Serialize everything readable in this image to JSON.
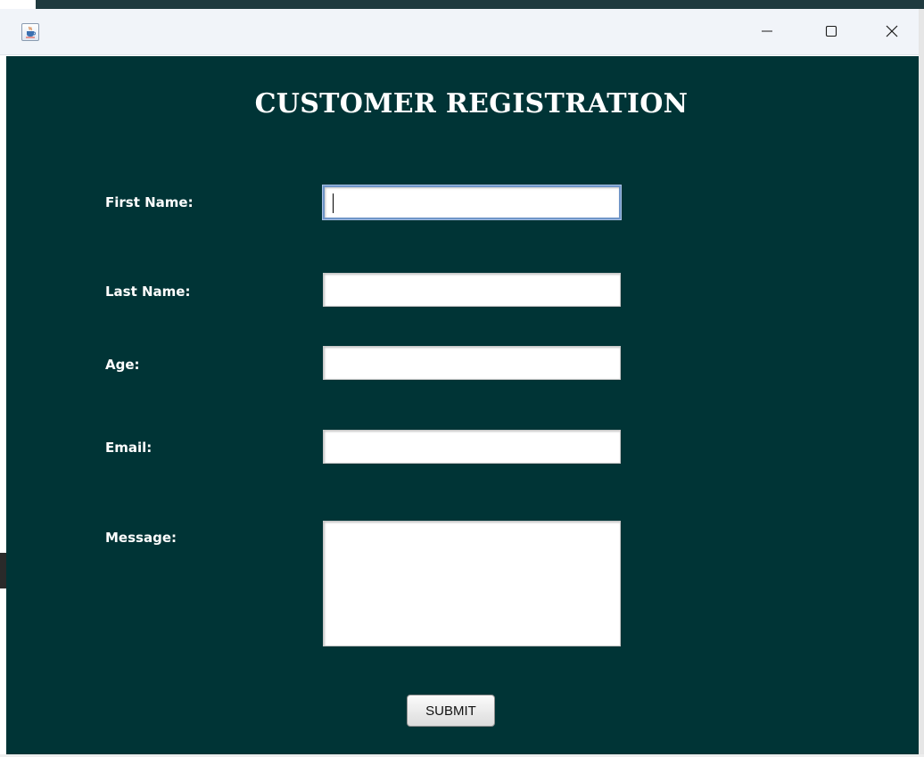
{
  "window": {
    "icon": "java-coffee-cup-icon",
    "controls": {
      "minimize_icon": "minimize-icon",
      "minimize_glyph": "—",
      "maximize_icon": "maximize-icon",
      "close_icon": "close-icon",
      "close_glyph": "✕"
    }
  },
  "form": {
    "title": "CUSTOMER REGISTRATION",
    "fields": {
      "first_name": {
        "label": "First Name:",
        "value": ""
      },
      "last_name": {
        "label": "Last Name:",
        "value": ""
      },
      "age": {
        "label": "Age:",
        "value": ""
      },
      "email": {
        "label": "Email:",
        "value": ""
      },
      "message": {
        "label": "Message:",
        "value": ""
      }
    },
    "submit_label": "SUBMIT"
  },
  "colors": {
    "background": "#003436",
    "title_text": "#ffffff",
    "titlebar": "#f1f4f9",
    "focus_border": "#6f95c8"
  }
}
